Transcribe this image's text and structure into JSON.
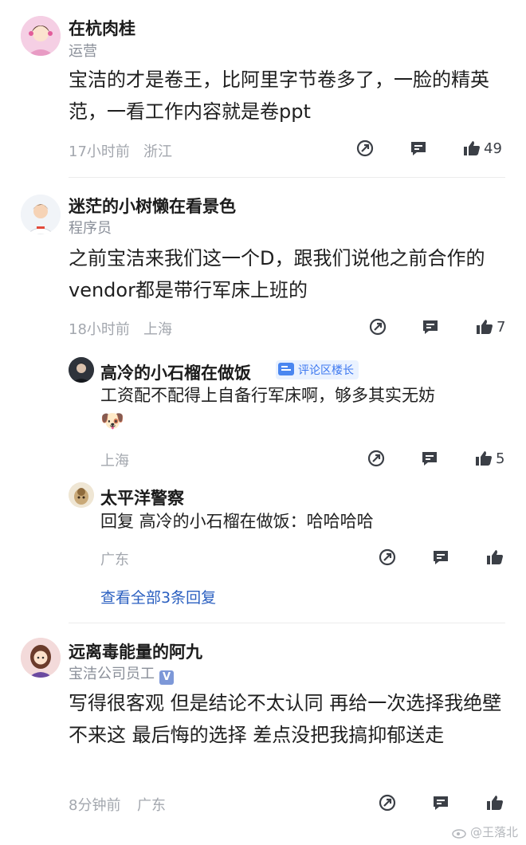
{
  "comments": [
    {
      "name": "在杭肉桂",
      "subtitle": "运营",
      "text": "宝洁的才是卷王，比阿里字节卷多了，一脸的精英范，一看工作内容就是卷ppt",
      "time": "17小时前",
      "location": "浙江",
      "likes": "49"
    },
    {
      "name": "迷茫的小树懒在看景色",
      "subtitle": "程序员",
      "text": "之前宝洁来我们这一个D，跟我们说他之前合作的vendor都是带行军床上班的",
      "time": "18小时前",
      "location": "上海",
      "likes": "7",
      "replies": [
        {
          "name": "高冷的小石榴在做饭",
          "badge": "评论区楼长",
          "text": "工资配不配得上自备行军床啊，够多其实无妨",
          "emoji": "🐶",
          "location": "上海",
          "likes": "5"
        },
        {
          "name": "太平洋警察",
          "text": "回复 高冷的小石榴在做饭：哈哈哈哈",
          "location": "广东",
          "likes": ""
        }
      ],
      "view_all": "查看全部3条回复"
    },
    {
      "name": "远离毒能量的阿九",
      "subtitle": "宝洁公司员工",
      "verified": "V",
      "text": "写得很客观 但是结论不太认同 再给一次选择我绝壁不来这 最后悔的选择 差点没把我搞抑郁送走",
      "time": "8分钟前",
      "location": "广东",
      "likes": ""
    }
  ],
  "watermark": "@王落北",
  "colors": {
    "link": "#2a5fc0",
    "meta": "#a3a7ae",
    "badge_bg": "#eaf2ff",
    "badge_text": "#3d78f0"
  }
}
